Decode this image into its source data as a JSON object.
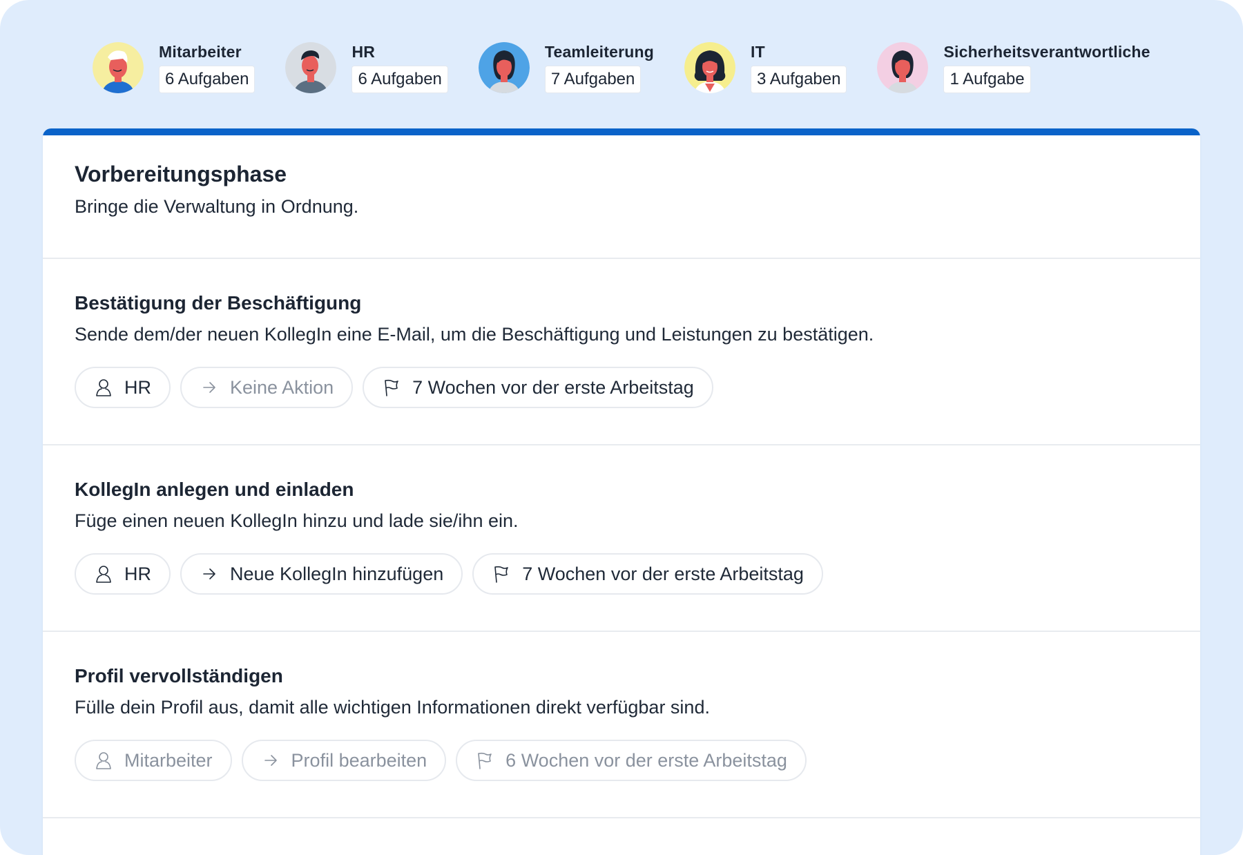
{
  "roles": [
    {
      "name": "Mitarbeiter",
      "count": "6 Aufgaben",
      "avatar_bg": "#f6eea0",
      "icon": "employee-avatar-icon"
    },
    {
      "name": "HR",
      "count": "6 Aufgaben",
      "avatar_bg": "#d8dde3",
      "icon": "hr-avatar-icon"
    },
    {
      "name": "Teamleiterung",
      "count": "7 Aufgaben",
      "avatar_bg": "#4ea3e6",
      "icon": "team-lead-avatar-icon"
    },
    {
      "name": "IT",
      "count": "3 Aufgaben",
      "avatar_bg": "#f6ee8e",
      "icon": "it-avatar-icon"
    },
    {
      "name": "Sicherheitsverantwortliche",
      "count": "1 Aufgabe",
      "avatar_bg": "#f3cfe3",
      "icon": "security-officer-avatar-icon"
    }
  ],
  "phase": {
    "title": "Vorbereitungsphase",
    "subtitle": "Bringe die Verwaltung in Ordnung."
  },
  "tasks": [
    {
      "title": "Bestätigung der Beschäftigung",
      "description": "Sende dem/der neuen KollegIn eine E-Mail, um die Beschäftigung und Leistungen zu bestätigen.",
      "assignee": "HR",
      "action": "Keine Aktion",
      "due": "7 Wochen vor der erste Arbeitstag"
    },
    {
      "title": "KollegIn anlegen und einladen",
      "description": "Füge einen neuen KollegIn hinzu und lade sie/ihn ein.",
      "assignee": "HR",
      "action": "Neue KollegIn hinzufügen",
      "due": "7 Wochen vor der erste Arbeitstag"
    },
    {
      "title": "Profil vervollständigen",
      "description": "Fülle dein Profil aus, damit alle wichtigen Informationen direkt verfügbar sind.",
      "assignee": "Mitarbeiter",
      "action": "Profil bearbeiten",
      "due": "6 Wochen vor der erste Arbeitstag"
    }
  ],
  "colors": {
    "background": "#dfecfc",
    "accent": "#0a63c9",
    "muted_text": "#8a929e"
  }
}
